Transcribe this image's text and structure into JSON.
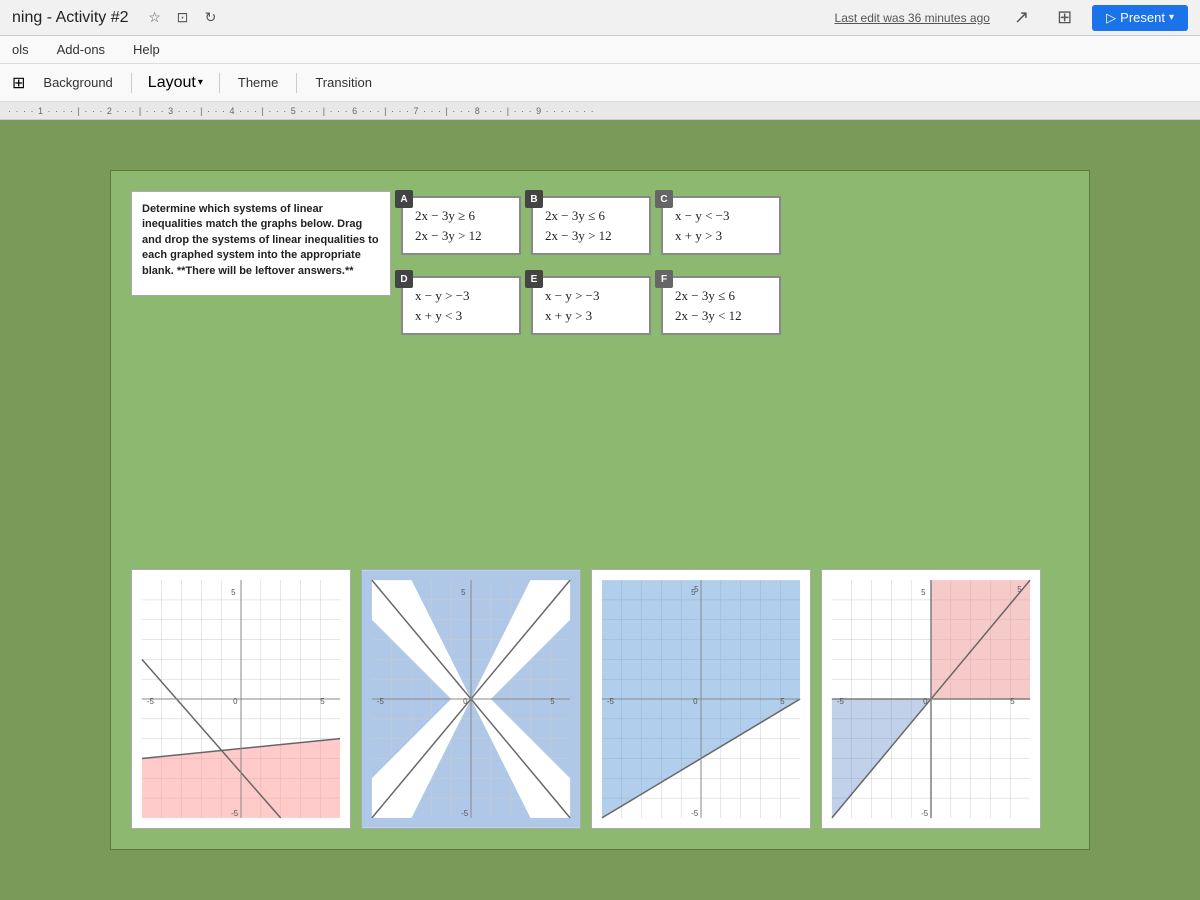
{
  "title": {
    "text": "ning - Activity #2",
    "last_edit": "Last edit was 36 minutes ago"
  },
  "menu": {
    "items": [
      "ols",
      "Add-ons",
      "Help"
    ]
  },
  "toolbar": {
    "background_label": "Background",
    "layout_label": "Layout",
    "theme_label": "Theme",
    "transition_label": "Transition",
    "present_label": "Present"
  },
  "ruler": {
    "marks": [
      "1",
      "2",
      "3",
      "4",
      "5",
      "6",
      "7",
      "8",
      "9"
    ]
  },
  "slide": {
    "instructions": {
      "title": "Determine which systems of linear inequalities match the graphs below.",
      "body": "Drag and drop the systems of linear inequalities to each graphed system into the appropriate blank. **There will be leftover answers.**"
    },
    "answer_cards": [
      {
        "label": "A",
        "line1": "2x − 3y ≥ 6",
        "line2": "2x − 3y > 12"
      },
      {
        "label": "B",
        "line1": "2x − 3y ≤ 6",
        "line2": "2x − 3y > 12"
      },
      {
        "label": "C",
        "line1": "x − y < −3",
        "line2": "x + y > 3"
      },
      {
        "label": "D",
        "line1": "x − y > −3",
        "line2": "x + y < 3"
      },
      {
        "label": "E",
        "line1": "x − y > −3",
        "line2": "x + y > 3"
      },
      {
        "label": "F",
        "line1": "2x − 3y ≤ 6",
        "line2": "2x − 3y < 12"
      }
    ],
    "graphs": [
      {
        "id": 1,
        "type": "diagonal-pink"
      },
      {
        "id": 2,
        "type": "x-cross-white"
      },
      {
        "id": 3,
        "type": "diagonal-blue-right"
      },
      {
        "id": 4,
        "type": "triangle-pink-blue"
      }
    ]
  }
}
